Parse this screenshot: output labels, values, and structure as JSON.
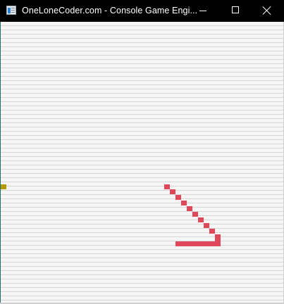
{
  "window": {
    "title": "OneLoneCoder.com - Console Game Engi...",
    "icon": "console-app-icon"
  },
  "controls": {
    "minimize_icon": "minimize-icon",
    "maximize_icon": "maximize-icon",
    "close_icon": "close-icon"
  },
  "game": {
    "food_color": "#b39a00",
    "snake_color": "#e0475a",
    "background_color": "#f5f5f5",
    "scanline_color": "#d6d6d6"
  }
}
